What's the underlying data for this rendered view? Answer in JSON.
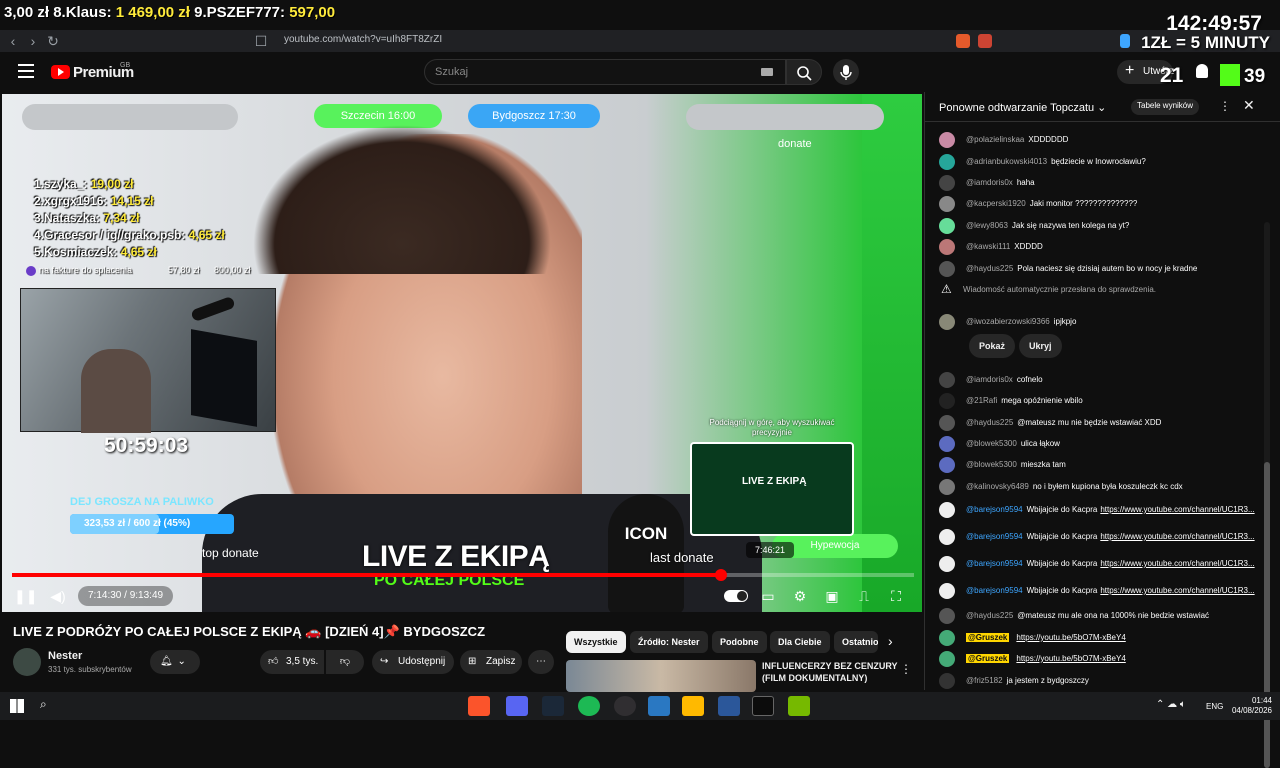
{
  "ticker": {
    "items": [
      {
        "rank": "",
        "name": "3,00 zł",
        "amount": ""
      },
      {
        "rank": "8.",
        "name": "Klaus:",
        "amount": "1 469,00 zł"
      },
      {
        "rank": "9.",
        "name": "PSZEF777:",
        "amount": "597,00"
      }
    ],
    "timer": "142:49:57",
    "rate": "1ZŁ = 5 MINUTY"
  },
  "browser": {
    "url": "youtube.com/watch?v=uIh8FT8ZrZI"
  },
  "youtube": {
    "logo_text": "Premium",
    "logo_region": "GB",
    "search_placeholder": "Szukaj",
    "create_label": "Utwórz",
    "badge_left": "21",
    "badge_right": "39"
  },
  "video": {
    "tag_left": "Szczecin 16:00",
    "tag_right": "Bydgoszcz 17:30",
    "donate_label": "donate",
    "overlay_title": "LIVE Z EKIPĄ",
    "overlay_sub": "PO CAŁEJ POLSCE",
    "last_donate": "last donate",
    "hyp_label": "Hypewocja",
    "mic_text": "ICON",
    "goal_label": "DEJ GROSZA NA PALIWKO",
    "goal_text": "323,53 zł / 600 zł (45%)",
    "goal_fraction": 0.54,
    "top_donate": "top donate",
    "donors": [
      {
        "label": "1.szyka_:",
        "amount": "19,00 zł"
      },
      {
        "label": "2.xgrgx1916:",
        "amount": "14,15 zł"
      },
      {
        "label": "3.Nataszka:",
        "amount": "7,34 zł"
      },
      {
        "label": "4.Gracesor / ig//grako.psb:",
        "amount": "4,65 zł"
      },
      {
        "label": "5.Kosmiaczek:",
        "amount": "4,65 zł"
      }
    ],
    "invoice_label": "na fakture do splacenia",
    "invoice_progress": "57,80 zł",
    "invoice_total": "800,00 zł",
    "cam_timer": "50:59:03",
    "seek_hint": "Podciągnij w górę, aby wyszukiwać precyzyjnie",
    "seek_preview_title": "LIVE Z EKIPĄ",
    "seek_time": "7:46:21",
    "current_time": "7:14:30",
    "duration": "9:13:49",
    "progress_fraction": 0.786
  },
  "meta": {
    "title": "LIVE Z PODRÓŻY PO CAŁEJ POLSCE Z EKIPĄ 🚗 [DZIEŃ 4]📌 BYDGOSZCZ",
    "channel": "Nester",
    "subs": "331 tys. subskrybentów",
    "likes": "3,5 tys.",
    "share": "Udostępnij",
    "save": "Zapisz"
  },
  "chips": [
    "Wszystkie",
    "Źródło: Nester",
    "Podobne",
    "Dla Ciebie",
    "Ostatnio"
  ],
  "recommendation": {
    "title": "INFLUENCERZY BEZ CENZURY (FILM DOKUMENTALNY)"
  },
  "chat": {
    "title": "Ponowne odtwarzanie Topczatu",
    "leaderboard": "Tabele wyników",
    "auto_note": "Wiadomość automatycznie przesłana do sprawdzenia.",
    "show_label": "Pokaż",
    "hide_label": "Ukryj",
    "messages": [
      {
        "user": "@polazielinskaa",
        "text": "XDDDDDD",
        "color": "#c98aa5"
      },
      {
        "user": "@adrianbukowski4013",
        "text": "będziecie w Inowrocławiu?",
        "color": "#26a69a"
      },
      {
        "user": "@iamdoris0x",
        "text": "haha",
        "color": "#444"
      },
      {
        "user": "@kacperski1920",
        "text": "Jaki monitor ??????????????",
        "color": "#888"
      },
      {
        "user": "@lewy8063",
        "text": "Jak się nazywa ten kolega na yt?",
        "color": "#6d9"
      },
      {
        "user": "@kawski111",
        "text": "XDDDD",
        "color": "#b77"
      },
      {
        "user": "@haydus225",
        "text": "Pola naciesz się dzisiaj autem bo w nocy je kradne",
        "color": "#555"
      },
      {
        "user": "@iwozabierzowski9366",
        "text": "ipjkpjo",
        "color": "#887"
      },
      {
        "user": "@iamdoris0x",
        "text": "cofnelo",
        "color": "#444"
      },
      {
        "user": "@21Rafi",
        "text": "mega opóźnienie wbilo",
        "color": "#222"
      },
      {
        "user": "@haydus225",
        "text": "@mateusz mu nie będzie wstawiać XDD",
        "color": "#555"
      },
      {
        "user": "@blowek5300",
        "text": "ulica łąkow",
        "color": "#5c6bc0"
      },
      {
        "user": "@blowek5300",
        "text": "mieszka tam",
        "color": "#5c6bc0"
      },
      {
        "user": "@kalinovsky6489",
        "text": "no i byłem kupiona była koszuleczk kc cdx",
        "color": "#777"
      },
      {
        "user": "@barejson9594",
        "text": "Wbijajcie do Kacpra",
        "link": "https://www.youtube.com/channel/UC1R3...",
        "color": "#eee"
      },
      {
        "user": "@barejson9594",
        "text": "Wbijajcie do Kacpra",
        "link": "https://www.youtube.com/channel/UC1R3...",
        "color": "#eee"
      },
      {
        "user": "@barejson9594",
        "text": "Wbijajcie do Kacpra",
        "link": "https://www.youtube.com/channel/UC1R3...",
        "color": "#eee"
      },
      {
        "user": "@barejson9594",
        "text": "Wbijajcie do Kacpra",
        "link": "https://www.youtube.com/channel/UC1R3...",
        "color": "#eee"
      },
      {
        "user": "@haydus225",
        "text": "@mateusz mu ale ona na 1000% nie bedzie wstawiać",
        "color": "#555"
      },
      {
        "user": "@Gruszek",
        "text": "",
        "link": "https://youtu.be/5bO7M-xBeY4",
        "color": "#4a7",
        "mod": true
      },
      {
        "user": "@Gruszek",
        "text": "",
        "link": "https://youtu.be/5bO7M-xBeY4",
        "color": "#4a7",
        "mod": true
      },
      {
        "user": "@friz5182",
        "text": "ja jestem z bydgoszczy",
        "color": "#333"
      }
    ]
  },
  "taskbar": {
    "lang": "ENG",
    "time": "01:44",
    "date": "04/08/2026"
  }
}
